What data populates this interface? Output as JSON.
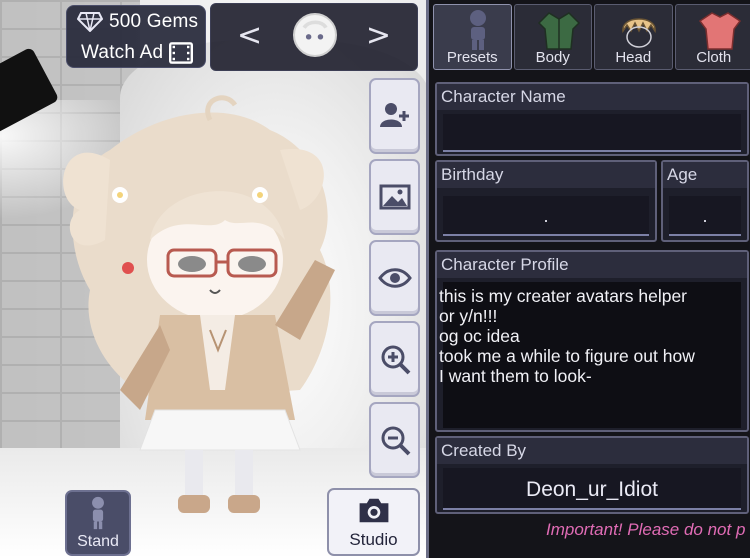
{
  "hud": {
    "gems_label": "500 Gems",
    "watch_ad_label": "Watch Ad",
    "prev_arrow": "<",
    "next_arrow": ">"
  },
  "tools": [
    "add-character-icon",
    "background-image-icon",
    "eye-icon",
    "zoom-in-icon",
    "zoom-out-icon"
  ],
  "bottom": {
    "stand_label": "Stand",
    "studio_label": "Studio"
  },
  "tabs": [
    {
      "label": "Presets",
      "icon": "preset-figure-icon"
    },
    {
      "label": "Body",
      "icon": "jacket-icon"
    },
    {
      "label": "Head",
      "icon": "hair-icon"
    },
    {
      "label": "Cloth",
      "icon": "shirt-icon"
    }
  ],
  "form": {
    "name_label": "Character Name",
    "name_value": "",
    "birthday_label": "Birthday",
    "birthday_value": ".",
    "age_label": "Age",
    "age_value": ".",
    "profile_label": "Character Profile",
    "profile_text": "this is my creater avatars helper\nor y/n!!!\nog oc idea\ntook me a while to figure out how\nI want them to look-",
    "created_by_label": "Created By",
    "created_by_value": "Deon_ur_Idiot"
  },
  "notice": "Important! Please do not p",
  "colors": {
    "panel_bg": "#141419",
    "field_bg": "#1e1f2b",
    "accent_line": "#7c80a6",
    "notice": "#e06cb5"
  }
}
